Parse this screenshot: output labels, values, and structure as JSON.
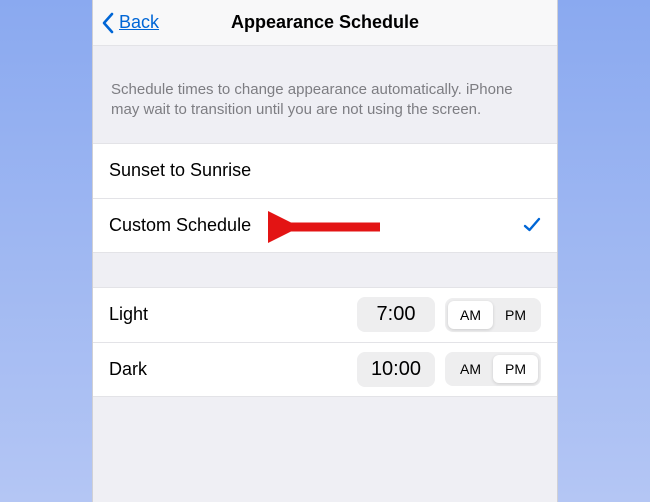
{
  "nav": {
    "back_label": "Back",
    "title": "Appearance Schedule"
  },
  "header": {
    "description": "Schedule times to change appearance automatically. iPhone may wait to transition until you are not using the screen."
  },
  "options": {
    "sunset": "Sunset to Sunrise",
    "custom": "Custom Schedule"
  },
  "schedule": {
    "light": {
      "label": "Light",
      "time": "7:00",
      "am": "AM",
      "pm": "PM",
      "selected": "AM"
    },
    "dark": {
      "label": "Dark",
      "time": "10:00",
      "am": "AM",
      "pm": "PM",
      "selected": "PM"
    }
  }
}
